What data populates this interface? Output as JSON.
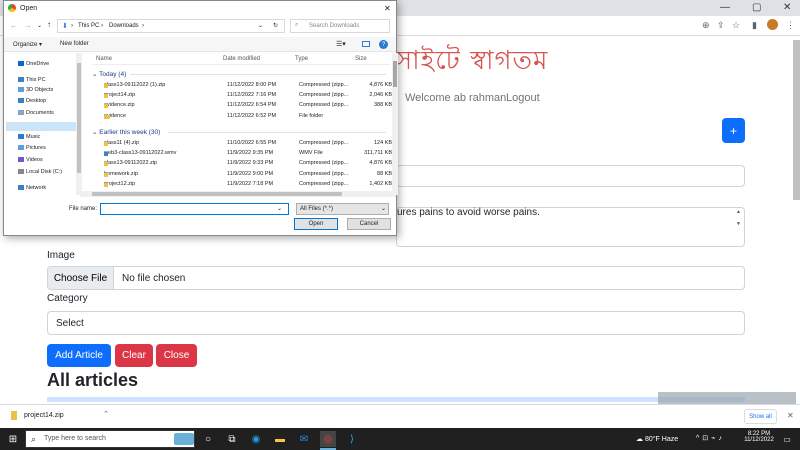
{
  "browser": {
    "toolbar_icons": [
      "zoom-icon",
      "share-icon",
      "star-icon",
      "sidebar-icon",
      "profile-icon",
      "menu-icon"
    ],
    "window_controls": {
      "minimize": "—",
      "maximize": "▢",
      "close": "✕"
    }
  },
  "page": {
    "title_bengali": "সাইটে স্বাগতম",
    "nav": {
      "welcome": "Welcome ab rahman",
      "logout": "Logout"
    },
    "add_button": "+",
    "description_text": "ures pains to avoid worse pains.",
    "image_label": "Image",
    "choose_file": "Choose File",
    "no_file": "No file chosen",
    "category_label": "Category",
    "category_select": "Select",
    "buttons": {
      "add_article": "Add Article",
      "clear": "Clear",
      "close": "Close"
    },
    "all_articles": "All articles",
    "colors": {
      "primary": "#0d6efd",
      "danger": "#dc3545",
      "title": "#d9534f"
    }
  },
  "dialog": {
    "title": "Open",
    "close_icon": "✕",
    "breadcrumb": [
      "This PC",
      "Downloads"
    ],
    "search_placeholder": "Search Downloads",
    "organize": "Organize ▾",
    "new_folder": "New folder",
    "tree": [
      {
        "label": "OneDrive",
        "icon": "cloud-icon",
        "color": "#0a64d6"
      },
      {
        "label": "This PC",
        "icon": "pc-icon",
        "color": "#3b82c4"
      },
      {
        "label": "3D Objects",
        "icon": "cube-icon",
        "color": "#5aa0e0"
      },
      {
        "label": "Desktop",
        "icon": "desktop-icon",
        "color": "#3b82c4"
      },
      {
        "label": "Documents",
        "icon": "documents-icon",
        "color": "#8ba3c0"
      },
      {
        "label": "Downloads",
        "icon": "download-icon",
        "color": "#2b7bd6"
      },
      {
        "label": "Music",
        "icon": "music-icon",
        "color": "#2b7bd6"
      },
      {
        "label": "Pictures",
        "icon": "pictures-icon",
        "color": "#5aa0e0"
      },
      {
        "label": "Videos",
        "icon": "videos-icon",
        "color": "#6a5acd"
      },
      {
        "label": "Local Disk (C:)",
        "icon": "disk-icon",
        "color": "#888888"
      },
      {
        "label": "Network",
        "icon": "network-icon",
        "color": "#3b82c4"
      }
    ],
    "columns": {
      "name": "Name",
      "date": "Date modified",
      "type": "Type",
      "size": "Size"
    },
    "groups": [
      {
        "label": "Today (4)",
        "files": [
          {
            "name": "class13-09112022 (1).zip",
            "date": "11/12/2022 8:00 PM",
            "type": "Compressed (zipp...",
            "size": "4,876 KB",
            "kind": "zip"
          },
          {
            "name": "project14.zip",
            "date": "11/12/2022 7:16 PM",
            "type": "Compressed (zipp...",
            "size": "2,046 KB",
            "kind": "zip"
          },
          {
            "name": "evidence.zip",
            "date": "11/12/2022 6:54 PM",
            "type": "Compressed (zipp...",
            "size": "388 KB",
            "kind": "zip"
          },
          {
            "name": "evidence",
            "date": "11/12/2022 6:52 PM",
            "type": "File folder",
            "size": "",
            "kind": "folder"
          }
        ]
      },
      {
        "label": "Earlier this week (30)",
        "files": [
          {
            "name": "class11 (4).zip",
            "date": "11/10/2022 6:55 PM",
            "type": "Compressed (zipp...",
            "size": "124 KB",
            "kind": "zip"
          },
          {
            "name": "web3-class13-09112022.wmv",
            "date": "11/9/2022 9:35 PM",
            "type": "WMV File",
            "size": "311,711 KB",
            "kind": "video"
          },
          {
            "name": "class13-09112022.zip",
            "date": "11/9/2022 9:33 PM",
            "type": "Compressed (zipp...",
            "size": "4,876 KB",
            "kind": "zip"
          },
          {
            "name": "homework.zip",
            "date": "11/9/2022 9:00 PM",
            "type": "Compressed (zipp...",
            "size": "88 KB",
            "kind": "zip"
          },
          {
            "name": "project12.zip",
            "date": "11/9/2022 7:18 PM",
            "type": "Compressed (zipp...",
            "size": "1,402 KB",
            "kind": "zip"
          }
        ]
      }
    ],
    "file_name_label": "File name:",
    "file_name_value": "",
    "filter": "All Files (*.*)",
    "open_button": "Open",
    "cancel_button": "Cancel"
  },
  "download_bar": {
    "file": "project14.zip",
    "show_all": "Show all",
    "close": "✕"
  },
  "taskbar": {
    "search_placeholder": "Type here to search",
    "weather": "80°F  Haze",
    "time": "8:22 PM",
    "date": "11/12/2022"
  }
}
